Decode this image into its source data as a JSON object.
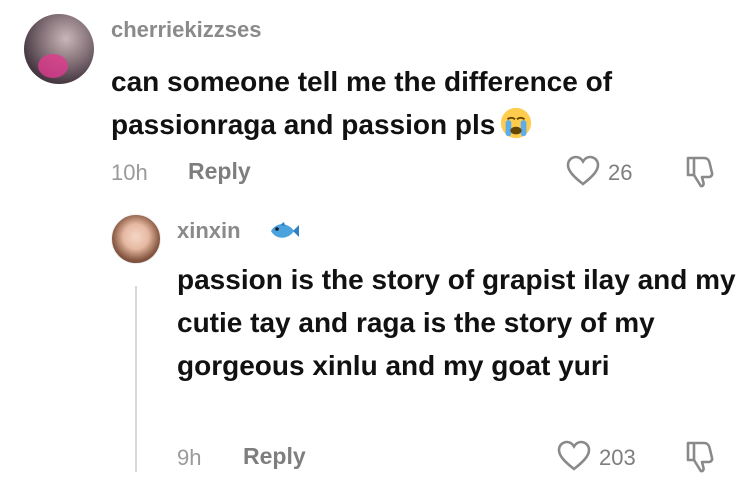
{
  "comment": {
    "username": "cherriekizzses",
    "text": "can someone tell me the difference of passionraga and passion pls",
    "emoji": "loudly-crying-face-emoji",
    "time": "10h",
    "reply_label": "Reply",
    "likes": "26"
  },
  "reply": {
    "username": "xinxin",
    "badge_emoji": "fish-emoji",
    "text": "passion is the story of grapist ilay and my cutie tay and raga is the story of my gorgeous xinlu and my goat yuri",
    "time": "9h",
    "reply_label": "Reply",
    "likes": "203"
  },
  "icons": {
    "like": "heart-outline-icon",
    "dislike": "thumbs-down-icon"
  }
}
